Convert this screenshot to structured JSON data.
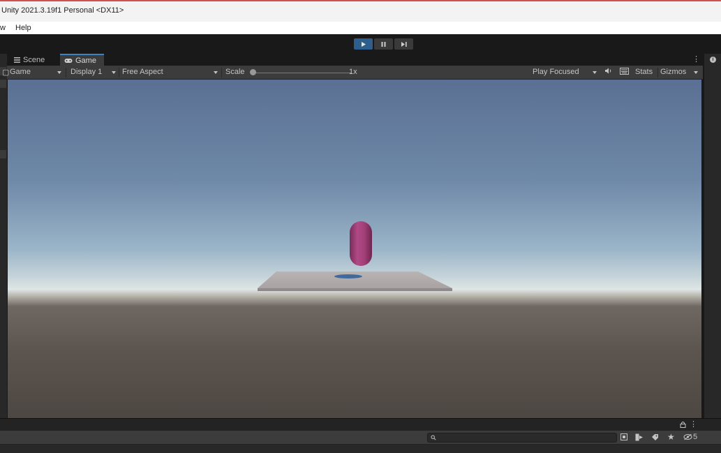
{
  "window": {
    "title": "Unity 2021.3.19f1 Personal <DX11>"
  },
  "menu": {
    "items": [
      "w",
      "Help"
    ]
  },
  "toolbar": {
    "play_state": "playing"
  },
  "tabs": [
    {
      "label": "Scene"
    },
    {
      "label": "Game"
    }
  ],
  "game_toolbar": {
    "view_mode": "Game",
    "display": "Display 1",
    "aspect": "Free Aspect",
    "scale_label": "Scale",
    "scale_value": "1x",
    "play_mode": "Play Focused",
    "stats": "Stats",
    "gizmos": "Gizmos"
  },
  "console": {
    "hidden_count": "5"
  },
  "colors": {
    "accent": "#3d82c2",
    "play_active": "#2e5f8c",
    "capsule": "#a33f78",
    "plane": "#b3adaf",
    "shadow": "#3f6a9b"
  }
}
